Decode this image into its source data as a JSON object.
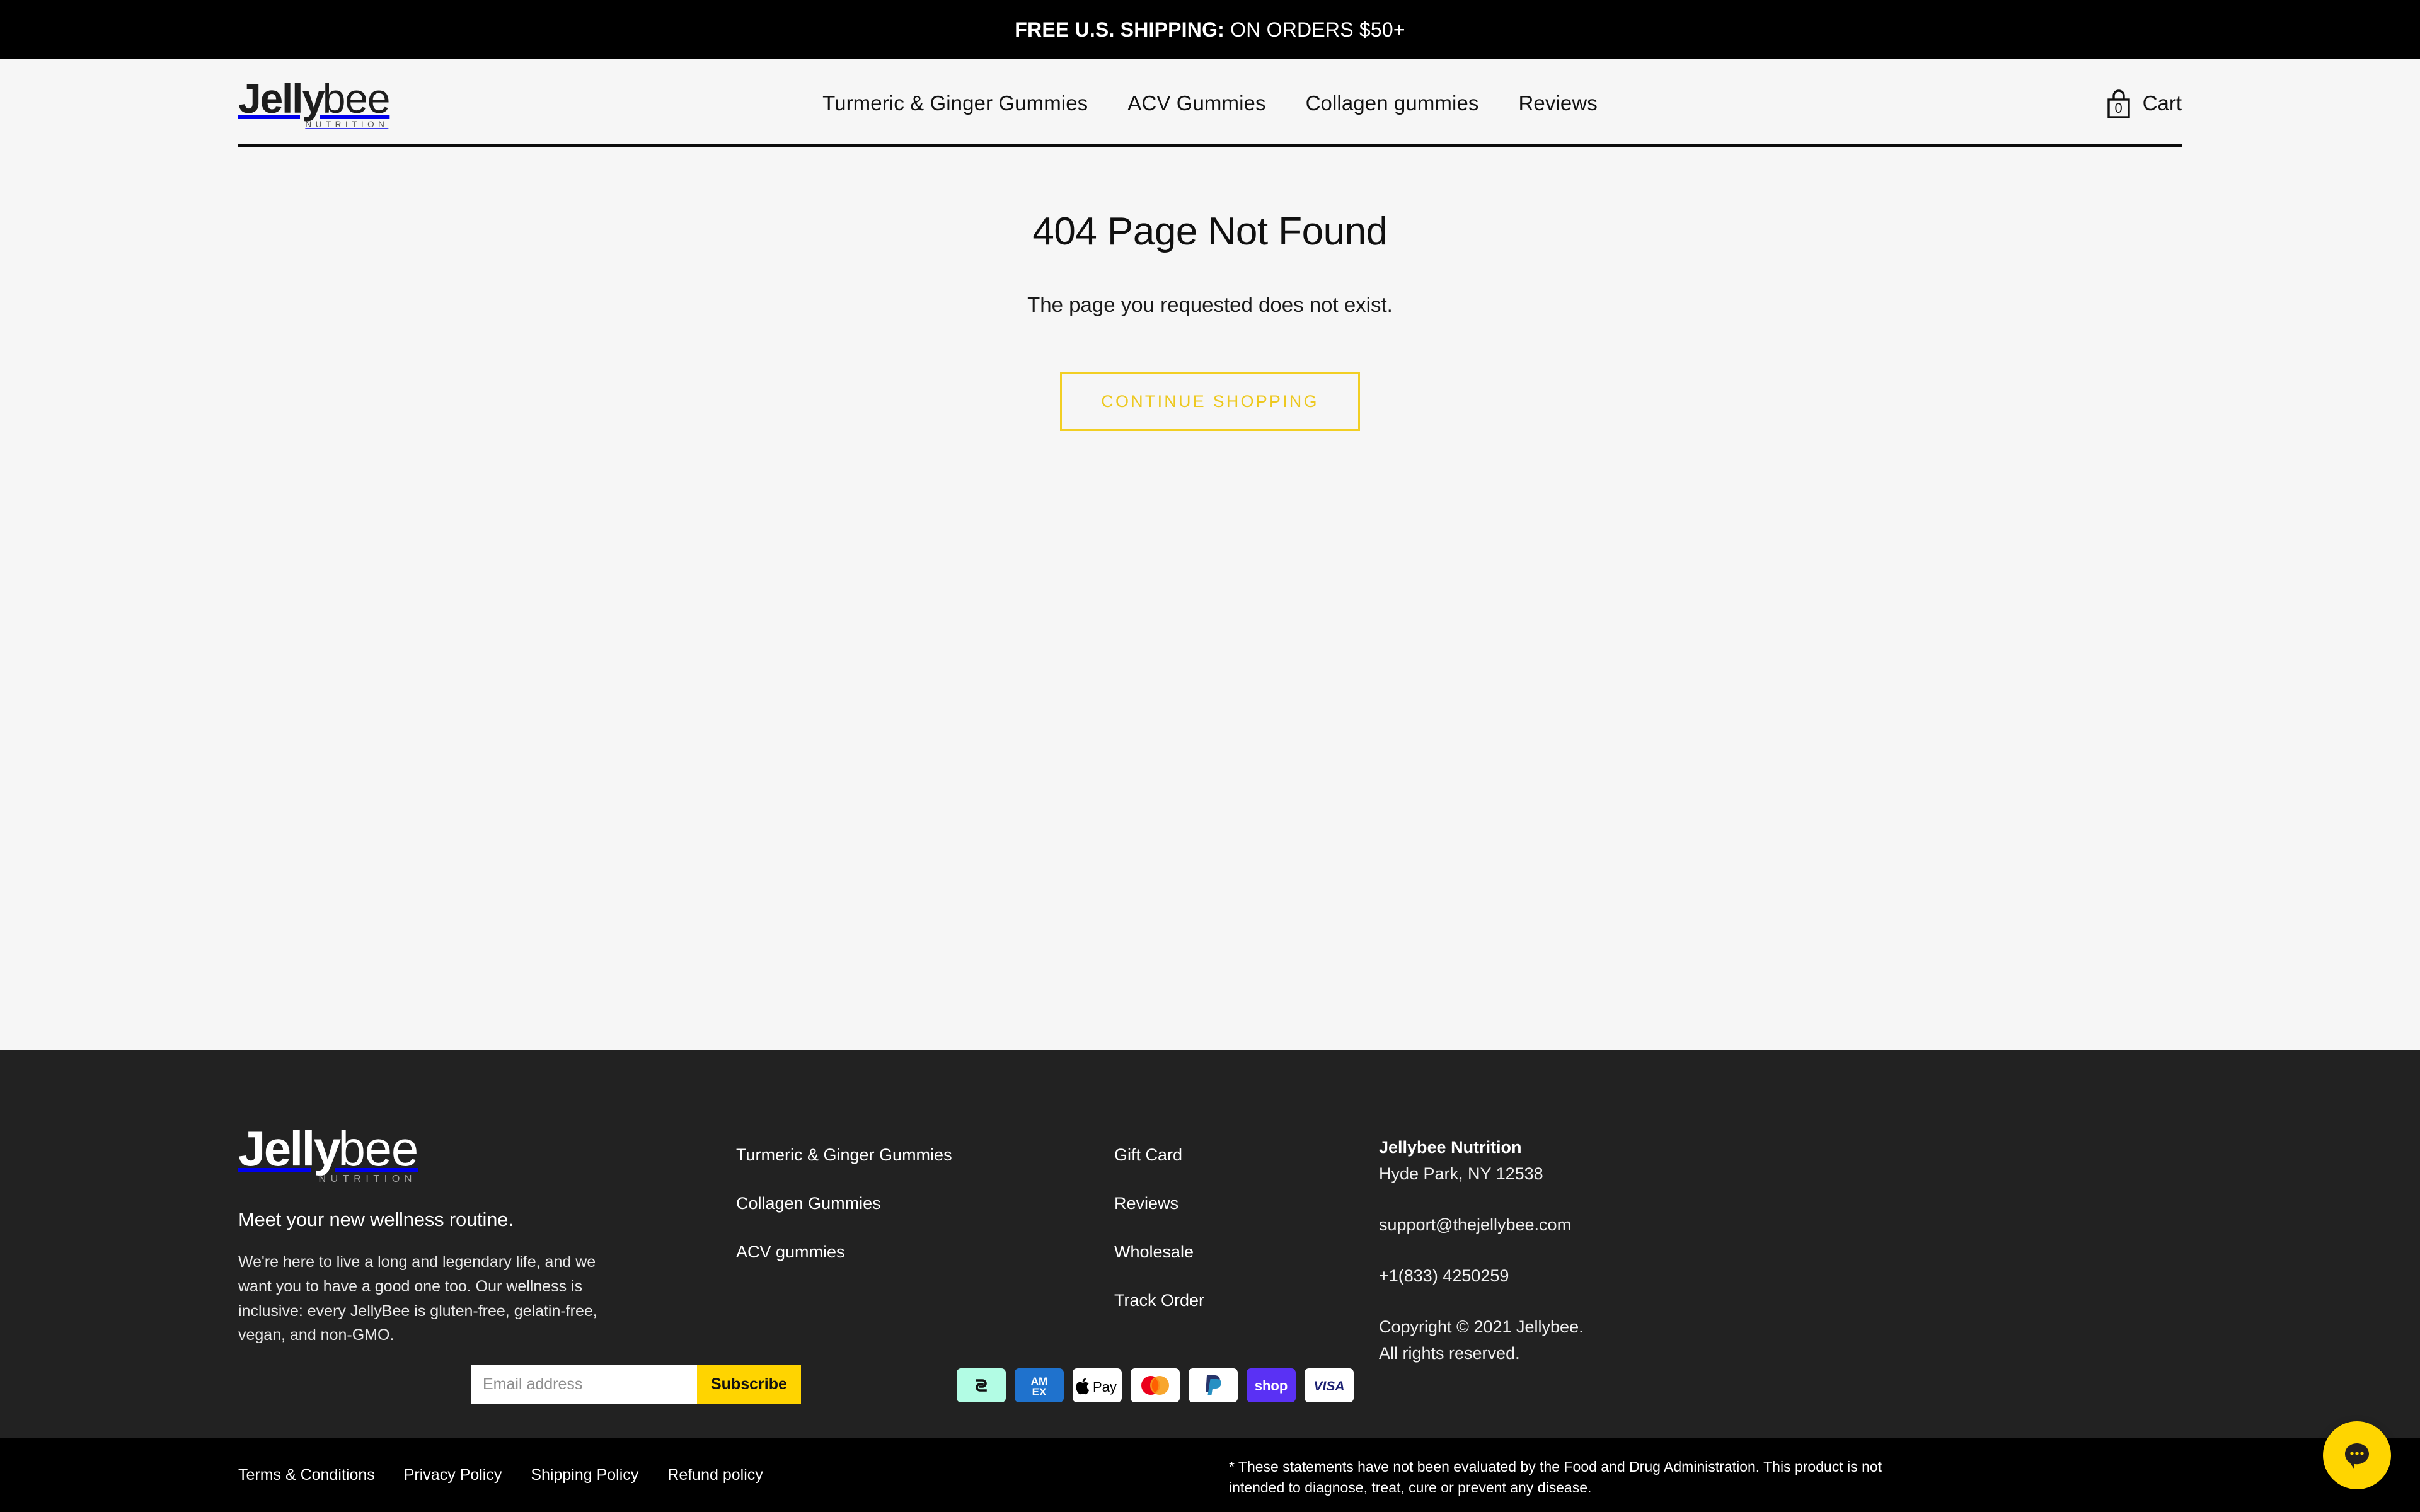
{
  "announcement": {
    "strong": "FREE U.S. SHIPPING:",
    "normal": " ON ORDERS $50+"
  },
  "brand": {
    "logo_bold": "Jelly",
    "logo_light": "bee",
    "logo_sub": "NUTRITION"
  },
  "header": {
    "nav": [
      {
        "label": "Turmeric & Ginger Gummies"
      },
      {
        "label": "ACV Gummies"
      },
      {
        "label": "Collagen gummies"
      },
      {
        "label": "Reviews"
      }
    ],
    "cart": {
      "count": "0",
      "label": "Cart",
      "icon": "shopping-bag-icon"
    }
  },
  "main": {
    "title": "404 Page Not Found",
    "subtitle": "The page you requested does not exist.",
    "cta_label": "CONTINUE SHOPPING",
    "cta_color": "#f2cf24"
  },
  "footer": {
    "tagline": "Meet your new wellness routine.",
    "blurb": "We're here to live a long and legendary life, and we want you to have a good one too. Our wellness is inclusive: every JellyBee is gluten-free, gelatin-free, vegan, and non-GMO.",
    "links_col1": [
      {
        "label": "Turmeric & Ginger Gummies"
      },
      {
        "label": "Collagen Gummies"
      },
      {
        "label": "ACV gummies"
      }
    ],
    "links_col2": [
      {
        "label": "Gift Card"
      },
      {
        "label": "Reviews"
      },
      {
        "label": "Wholesale"
      },
      {
        "label": "Track Order"
      }
    ],
    "contact": {
      "name": "Jellybee Nutrition",
      "address": "Hyde Park, NY 12538",
      "email": "support@thejellybee.com",
      "phone": "+1(833) 4250259",
      "copyright_line1": "Copyright © 2021 Jellybee.",
      "copyright_line2": "All rights reserved."
    },
    "newsletter": {
      "placeholder": "Email address",
      "value": "",
      "button_label": "Subscribe",
      "button_color": "#ffd400"
    },
    "payments": [
      {
        "name": "afterpay-icon",
        "label": "Afterpay"
      },
      {
        "name": "amex-icon",
        "label": "AMEX"
      },
      {
        "name": "apple-pay-icon",
        "label": "Apple Pay"
      },
      {
        "name": "mastercard-icon",
        "label": "Mastercard"
      },
      {
        "name": "paypal-icon",
        "label": "PayPal"
      },
      {
        "name": "shop-pay-icon",
        "label": "shop"
      },
      {
        "name": "visa-icon",
        "label": "VISA"
      }
    ]
  },
  "bottombar": {
    "legal": [
      {
        "label": "Terms & Conditions"
      },
      {
        "label": "Privacy Policy"
      },
      {
        "label": "Shipping Policy"
      },
      {
        "label": "Refund policy"
      }
    ],
    "disclaimer": "* These statements have not been evaluated by the Food and Drug Administration. This product is not intended to diagnose, treat, cure or prevent any disease."
  },
  "chat": {
    "icon": "chat-bubble-icon",
    "color": "#ffd500"
  }
}
